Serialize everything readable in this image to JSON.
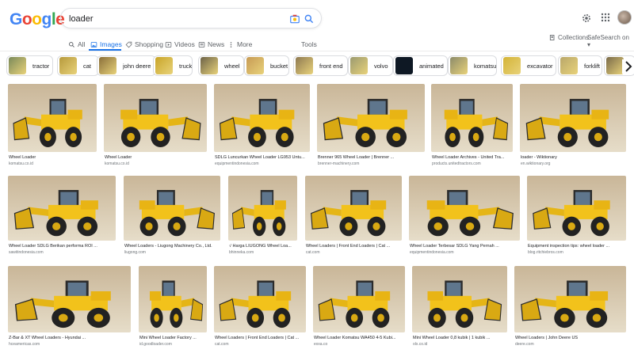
{
  "logo": [
    "G",
    "o",
    "o",
    "g",
    "l",
    "e"
  ],
  "logo_colors": [
    "#4285F4",
    "#EA4335",
    "#FBBC05",
    "#4285F4",
    "#34A853",
    "#EA4335"
  ],
  "search": {
    "value": "loader"
  },
  "tabs": [
    {
      "label": "All",
      "icon": "search-icon"
    },
    {
      "label": "Images",
      "icon": "image-icon",
      "active": true
    },
    {
      "label": "Shopping",
      "icon": "tag-icon"
    },
    {
      "label": "Videos",
      "icon": "play-icon"
    },
    {
      "label": "News",
      "icon": "news-icon"
    },
    {
      "label": "More",
      "icon": "more-icon"
    }
  ],
  "tools": "Tools",
  "collections": "Collections",
  "safesearch": "SafeSearch on",
  "chips": [
    {
      "label": "tractor",
      "color": "#7a8a5a"
    },
    {
      "label": "cat",
      "color": "#b79a3c"
    },
    {
      "label": "john deere",
      "color": "#8a6f3a"
    },
    {
      "label": "truck",
      "color": "#c9a528"
    },
    {
      "label": "wheel",
      "color": "#6c6248"
    },
    {
      "label": "bucket",
      "color": "#c79b55"
    },
    {
      "label": "front end",
      "color": "#8f7a52"
    },
    {
      "label": "volvo",
      "color": "#9b9a70"
    },
    {
      "label": "animated",
      "color": "#0e1824"
    },
    {
      "label": "komatsu",
      "color": "#8c8b6a"
    },
    {
      "label": "excavator",
      "color": "#d4b437"
    },
    {
      "label": "forklift",
      "color": "#b9a76a"
    },
    {
      "label": "",
      "color": "#7a6b4a"
    }
  ],
  "results": [
    {
      "title": "Wheel Loader",
      "source": "komatsu.co.id",
      "bg": "#c9b698",
      "bg2": "#e6ddc9"
    },
    {
      "title": "Wheel Loader",
      "source": "komatsu.co.id",
      "bg": "#c7b48f",
      "bg2": "#e8e0cc"
    },
    {
      "title": "SDLG Luncurkan Wheel Loader LG953 Untu...",
      "source": "equipmentindonesia.com",
      "bg": "#9fb0c2",
      "bg2": "#cfd8e2"
    },
    {
      "title": "Brenner 965 Wheel Loader | Brenner ...",
      "source": "brenner-machinery.com",
      "bg": "#b8a07a",
      "bg2": "#d9c9a8"
    },
    {
      "title": "Wheel Loader Archives - United Tra...",
      "source": "products.unitedtractors.com",
      "bg": "#ffffff",
      "bg2": "#f4f4f4"
    },
    {
      "title": "loader - Wiktionary",
      "source": "en.wiktionary.org",
      "bg": "#8fa4bd",
      "bg2": "#d8d2c1"
    },
    {
      "title": "Wheel Loader SDLG Berikan performa ROI ...",
      "source": "sawitindonesia.com",
      "bg": "#a3b1bf",
      "bg2": "#d6d2c4"
    },
    {
      "title": "Wheel Loaders - Liugong Machinery Co., Ltd.",
      "source": "liugong.com",
      "bg": "#ffffff",
      "bg2": "#f5f5f5"
    },
    {
      "title": "√ Harga LIUGONG Wheel Loa...",
      "source": "bhinneka.com",
      "bg": "#ffffff",
      "bg2": "#f3f3f3"
    },
    {
      "title": "Wheel Loaders | Front End Loaders | Cat ...",
      "source": "cat.com",
      "bg": "#ffffff",
      "bg2": "#f2f2f2"
    },
    {
      "title": "Wheel Loader Terbesar SDLG Yang Pernah ...",
      "source": "equipmentindonesia.com",
      "bg": "#b6a487",
      "bg2": "#d5c8b1"
    },
    {
      "title": "Equipment inspection tips: wheel loader ...",
      "source": "blog.ritchiebros.com",
      "bg": "#a9c4da",
      "bg2": "#a3b58a"
    },
    {
      "title": "Z-Bar & XT Wheel Loaders - Hyundai ...",
      "source": "hceamericas.com",
      "bg": "#ffffff",
      "bg2": "#f4f4f4"
    },
    {
      "title": "Mini Wheel Loader Factory ...",
      "source": "id.goodloader.com",
      "bg": "#ffffff",
      "bg2": "#f5f5f5"
    },
    {
      "title": "Wheel Loaders | Front End Loaders | Cat ...",
      "source": "cat.com",
      "bg": "#ffffff",
      "bg2": "#f2f2f2"
    },
    {
      "title": "Wheel Loader Komatsu WA450 4-5 Kubi...",
      "source": "exxa.co",
      "bg": "#9bb0c6",
      "bg2": "#b9b39b"
    },
    {
      "title": "Mini Wheel Loader 0,8 kubik | 1 kubik ...",
      "source": "olx.co.id",
      "bg": "#8fa06c",
      "bg2": "#b7b49a"
    },
    {
      "title": "Wheel Loaders | John Deere US",
      "source": "deere.com",
      "bg": "#b9c2c9",
      "bg2": "#c9bfae"
    }
  ],
  "colors": {
    "accent": "#1a73e8",
    "loader_yellow": "#f2c21b",
    "loader_dark": "#2b2b2b"
  }
}
